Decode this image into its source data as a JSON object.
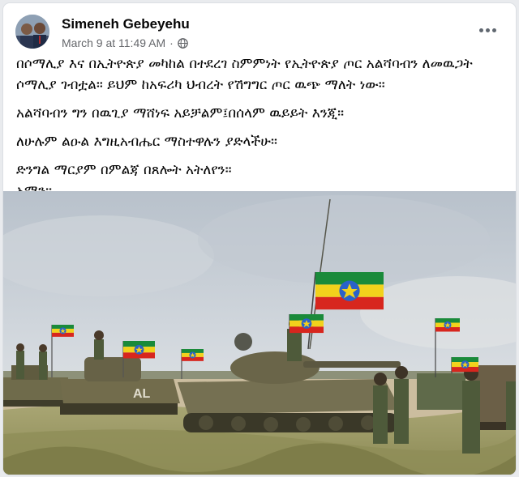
{
  "post": {
    "author": "Simeneh Gebeyehu",
    "timestamp": "March 9 at 11:49 AM",
    "separator": "·",
    "privacy_icon": "globe-icon",
    "more_icon": "more-options-icon",
    "paragraphs": [
      "በሶማሊያ እና በኢትዮጵያ መካከል በተደረገ ስምምነት የኢትዮጵያ ጦር አልሻባብን ለመዉጋት ሶማሊያ ገብቷል። ይህም ከአፍሪካ ህብረት የሽግግር ጦር ዉጭ ማለት ነው።",
      "አልሻባብን ግን በዉጊያ ማሸነፍ አይቻልም፤በሰላም ዉይይት እንጂ።",
      "ለሁሉም ልዑል እግዚአብሔር ማስተዋሉን ያድላችሁ።",
      "ድንግል ማርያም በምልጃ በጸሎት አትለየን።",
      "አሜን።"
    ]
  },
  "photo": {
    "tank_marking": "AL",
    "colors": {
      "sky": "#c9cfd6",
      "grass": "#9c9a63",
      "tank": "#6e6a4a",
      "flag_green": "#1a8a3a",
      "flag_yellow": "#f2d21c",
      "flag_red": "#d7261e",
      "emblem_blue": "#2a62c9"
    }
  }
}
